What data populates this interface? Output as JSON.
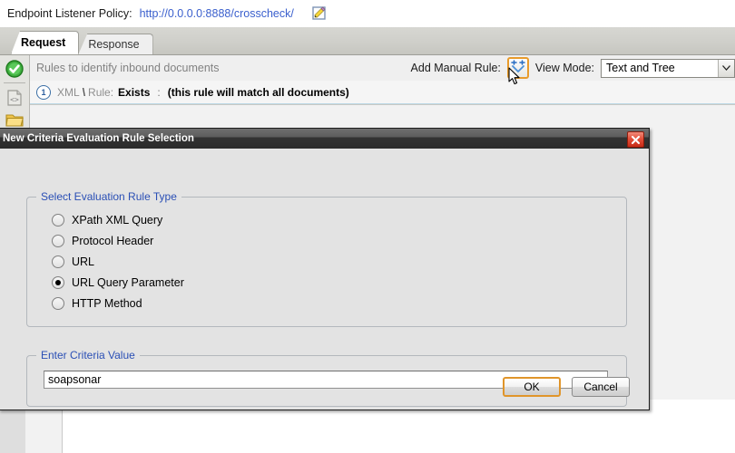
{
  "header": {
    "policy_label": "Endpoint Listener Policy:",
    "policy_url": "http://0.0.0.0:8888/crosscheck/",
    "edit_icon": "edit-pencil-icon"
  },
  "tabs": [
    {
      "label": "Request",
      "active": true
    },
    {
      "label": "Response",
      "active": false
    }
  ],
  "gutter": {
    "icons": [
      {
        "name": "status-ok-icon"
      },
      {
        "name": "xml-document-icon"
      },
      {
        "name": "folder-icon"
      }
    ]
  },
  "toolbar": {
    "hint": "Rules to identify inbound documents",
    "add_manual_rule_label": "Add Manual Rule:",
    "add_manual_rule_icon": "add-rule-arrows-icon",
    "view_mode_label": "View Mode:",
    "view_mode_value": "Text and Tree",
    "view_mode_options": [
      "Text and Tree"
    ]
  },
  "rule_row": {
    "number": "1",
    "type": "XML",
    "separator": "\\",
    "rule_label": "Rule:",
    "rule_value": "Exists",
    "colon": ":",
    "match_note": "(this rule will match all documents)"
  },
  "dialog": {
    "title": "New Criteria Evaluation Rule Selection",
    "close_icon": "close-x-icon",
    "rule_type_group_title": "Select Evaluation Rule Type",
    "rule_types": [
      {
        "label": "XPath XML Query",
        "selected": false
      },
      {
        "label": "Protocol Header",
        "selected": false
      },
      {
        "label": "URL",
        "selected": false
      },
      {
        "label": "URL Query Parameter",
        "selected": true
      },
      {
        "label": "HTTP Method",
        "selected": false
      }
    ],
    "criteria_group_title": "Enter Criteria Value",
    "criteria_value": "soapsonar",
    "criteria_placeholder": "",
    "ok_label": "OK",
    "cancel_label": "Cancel"
  },
  "colors": {
    "link_blue": "#3a5fcd",
    "group_title_blue": "#2a4fb5",
    "focus_orange": "#e0952a",
    "close_red": "#c62b17",
    "titlebar_dark": "#2b2b2b"
  }
}
